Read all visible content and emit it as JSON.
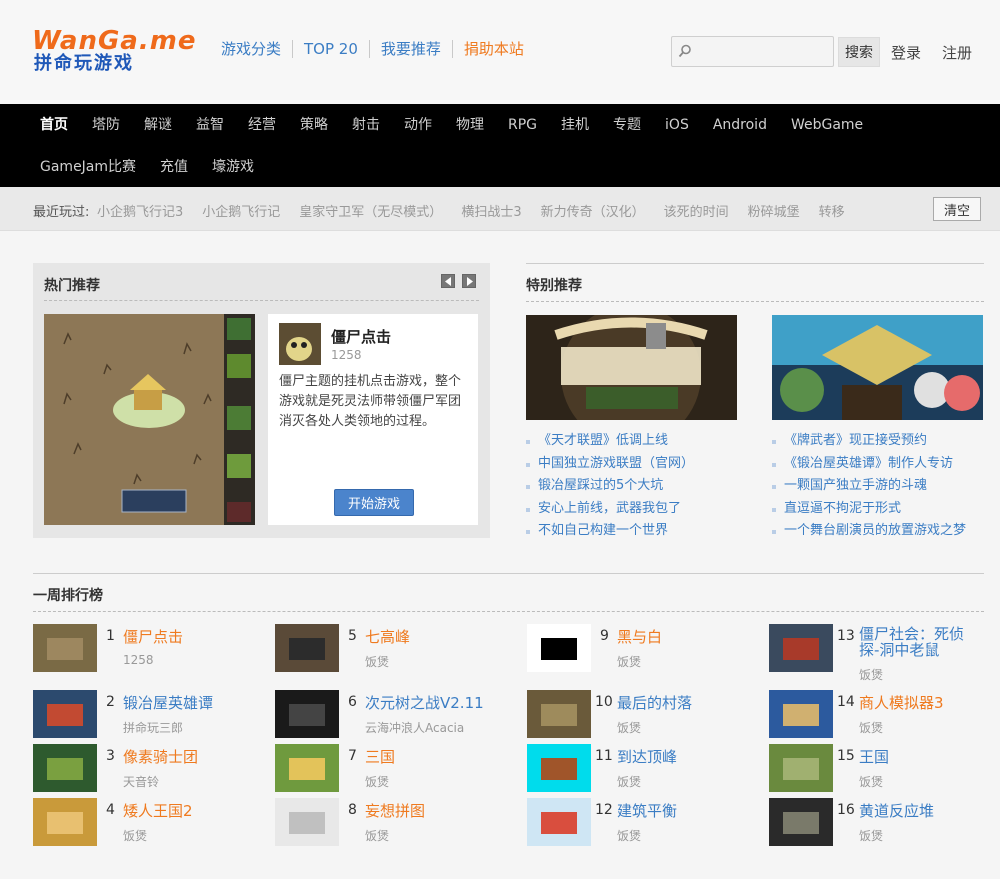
{
  "header": {
    "logo_line1": "WanGa.me",
    "logo_line2": "拼命玩游戏",
    "nav": [
      "游戏分类",
      "TOP 20",
      "我要推荐",
      "捐助本站"
    ],
    "search_placeholder": "",
    "search_button": "搜索",
    "login": "登录",
    "register": "注册",
    "accent": "#ef7a1f",
    "link_color": "#3b7dc4"
  },
  "categories": [
    "首页",
    "塔防",
    "解谜",
    "益智",
    "经营",
    "策略",
    "射击",
    "动作",
    "物理",
    "RPG",
    "挂机",
    "专题",
    "iOS",
    "Android",
    "WebGame",
    "GameJam比赛",
    "充值",
    "壕游戏"
  ],
  "recent": {
    "label": "最近玩过:",
    "items": [
      "小企鹅飞行记3",
      "小企鹅飞行记",
      "皇家守卫军（无尽模式）",
      "横扫战士3",
      "新力传奇（汉化）",
      "该死的时间",
      "粉碎城堡",
      "转移"
    ],
    "clear": "清空"
  },
  "hot": {
    "title": "热门推荐",
    "game_name": "僵尸点击",
    "game_count": "1258",
    "description": "僵尸主题的挂机点击游戏，整个游戏就是死灵法师带领僵尸军团消灭各处人类领地的过程。",
    "play_button": "开始游戏"
  },
  "special": {
    "title": "特别推荐",
    "left_links": [
      "《天才联盟》低调上线",
      "中国独立游戏联盟（官网）",
      "锻冶屋踩过的5个大坑",
      "安心上前线，武器我包了",
      "不如自己构建一个世界"
    ],
    "right_links": [
      "《牌武者》现正接受预约",
      "《锻冶屋英雄谭》制作人专访",
      "一颗国产独立手游的斗魂",
      "直逗逼不拘泥于形式",
      "一个舞台剧演员的放置游戏之梦"
    ]
  },
  "weekly": {
    "title": "一周排行榜",
    "items": [
      {
        "num": "1",
        "name": "僵尸点击",
        "author": "1258"
      },
      {
        "num": "2",
        "name": "锻冶屋英雄谭",
        "author": "拼命玩三郎"
      },
      {
        "num": "3",
        "name": "像素骑士团",
        "author": "天音铃"
      },
      {
        "num": "4",
        "name": "矮人王国2",
        "author": "饭煲"
      },
      {
        "num": "5",
        "name": "七高峰",
        "author": "饭煲"
      },
      {
        "num": "6",
        "name": "次元树之战V2.11",
        "author": "云海冲浪人Acacia"
      },
      {
        "num": "7",
        "name": "三国",
        "author": "饭煲"
      },
      {
        "num": "8",
        "name": "妄想拼图",
        "author": "饭煲"
      },
      {
        "num": "9",
        "name": "黑与白",
        "author": "饭煲"
      },
      {
        "num": "10",
        "name": "最后的村落",
        "author": "饭煲"
      },
      {
        "num": "11",
        "name": "到达顶峰",
        "author": "饭煲"
      },
      {
        "num": "12",
        "name": "建筑平衡",
        "author": "饭煲"
      },
      {
        "num": "13",
        "name": "僵尸社会：死侦探-洞中老鼠",
        "author": "饭煲"
      },
      {
        "num": "14",
        "name": "商人模拟器3",
        "author": "饭煲"
      },
      {
        "num": "15",
        "name": "王国",
        "author": "饭煲"
      },
      {
        "num": "16",
        "name": "黄道反应堆",
        "author": "饭煲"
      }
    ]
  }
}
